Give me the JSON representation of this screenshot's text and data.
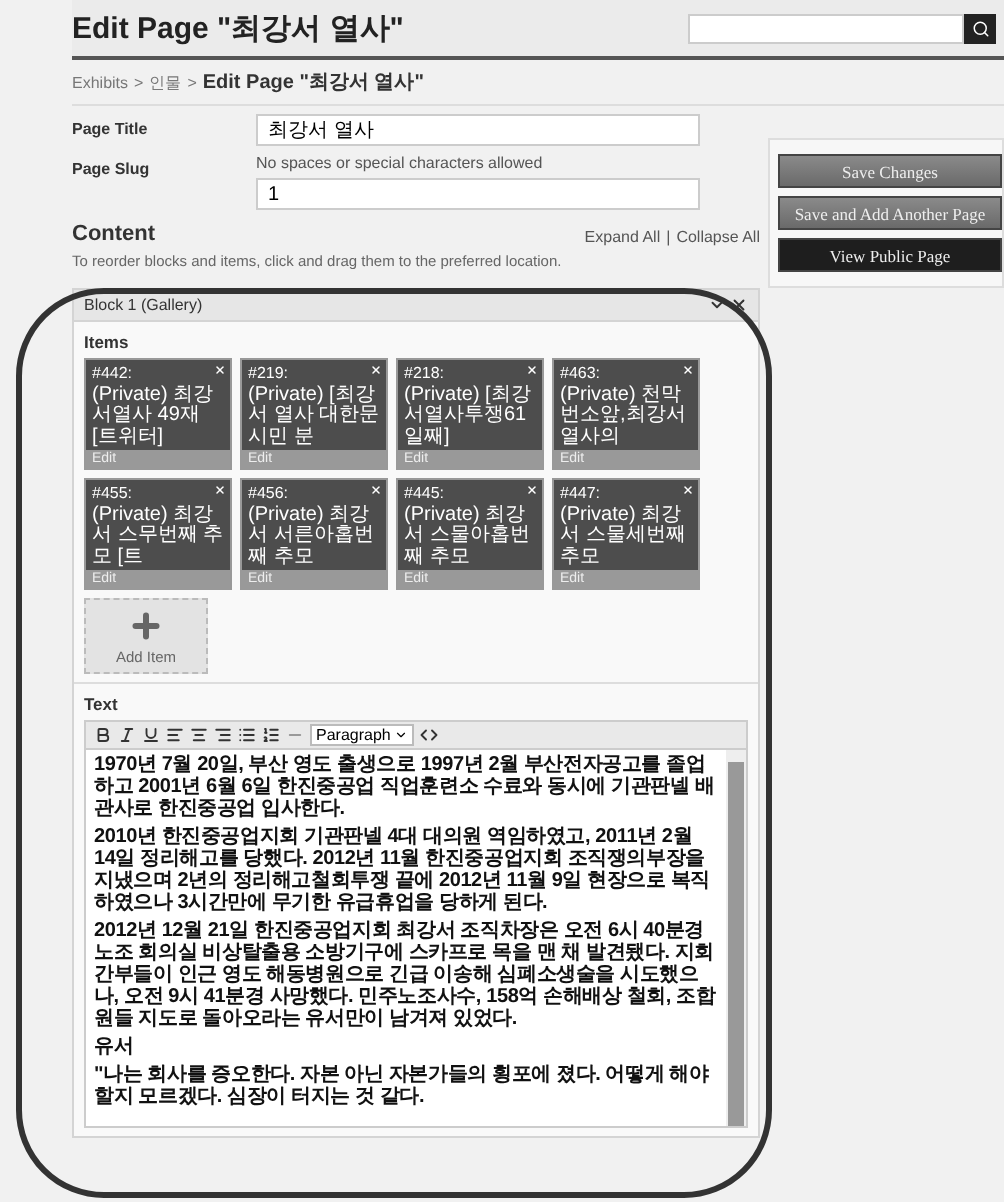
{
  "page": {
    "title": "Edit Page \"최강서 열사\""
  },
  "breadcrumb": {
    "items": [
      {
        "label": "Exhibits",
        "current": false
      },
      {
        "label": "인물",
        "current": false
      },
      {
        "label": "Edit Page \"최강서 열사\"",
        "current": true
      }
    ],
    "separators": [
      ">",
      ">"
    ]
  },
  "fields": [
    {
      "label": "Page Title",
      "value": "최강서 열사"
    },
    {
      "label": "Page Slug",
      "hint": "No spaces or special characters allowed",
      "value": "1"
    }
  ],
  "actions": [
    {
      "label": "Save Changes",
      "kind": "standard"
    },
    {
      "label": "Save and Add Another Page",
      "kind": "standard"
    },
    {
      "label": "View Public Page",
      "kind": "emphasis"
    }
  ],
  "content": {
    "heading": "Content",
    "links": [
      "Expand All",
      "Collapse All"
    ],
    "link_separator": "|",
    "instructions": "To reorder blocks and items, click and drag them to the preferred location."
  },
  "block": {
    "title": "Block 1 (Gallery)",
    "items_label": "Items",
    "items": [
      {
        "number": "#442:",
        "caption": "(Private) 최강서열사 49재 [트위터]",
        "edit": "Edit"
      },
      {
        "number": "#219:",
        "caption": "(Private) [최강서 열사 대한문 시민 분",
        "edit": "Edit"
      },
      {
        "number": "#218:",
        "caption": "(Private) [최강서열사투쟁61일째]",
        "edit": "Edit"
      },
      {
        "number": "#463:",
        "caption": "(Private) 천막번소앞,최강서 열사의",
        "edit": "Edit"
      },
      {
        "number": "#455:",
        "caption": "(Private) 최강서 스무번째 추모 [트",
        "edit": "Edit"
      },
      {
        "number": "#456:",
        "caption": "(Private) 최강서 서른아홉번째 추모",
        "edit": "Edit"
      },
      {
        "number": "#445:",
        "caption": "(Private) 최강서 스물아홉번째 추모",
        "edit": "Edit"
      },
      {
        "number": "#447:",
        "caption": "(Private) 최강서 스물세번째 추모",
        "edit": "Edit"
      }
    ],
    "add_item": "Add Item",
    "text_label": "Text",
    "format": "Paragraph",
    "paragraphs": [
      "1970년 7월 20일, 부산 영도 출생으로 1997년 2월 부산전자공고를 졸업하고 2001년 6월 6일 한진중공업 직업훈련소 수료와 동시에 기관판넬 배관사로 한진중공업 입사한다.",
      "2010년 한진중공업지회 기관판넬 4대 대의원 역임하였고, 2011년 2월 14일 정리해고를 당했다. 2012년 11월 한진중공업지회 조직쟁의부장을 지냈으며 2년의 정리해고철회투쟁 끝에 2012년 11월 9일 현장으로 복직하였으나 3시간만에 무기한 유급휴업을 당하게 된다.",
      "2012년 12월 21일 한진중공업지회 최강서 조직차장은 오전 6시 40분경 노조 회의실 비상탈출용 소방기구에 스카프로 목을 맨 채 발견됐다. 지회 간부들이 인근 영도 해동병원으로 긴급 이송해 심폐소생술을 시도했으나, 오전 9시 41분경 사망했다. 민주노조사수, 158억 손해배상 철회, 조합원들 지도로 돌아오라는 유서만이 남겨져 있었다.",
      "유서",
      "\"나는 회사를 증오한다. 자본 아닌 자본가들의 횡포에 졌다. 어떻게 해야할지 모르겠다. 심장이 터지는 것 같다."
    ]
  }
}
